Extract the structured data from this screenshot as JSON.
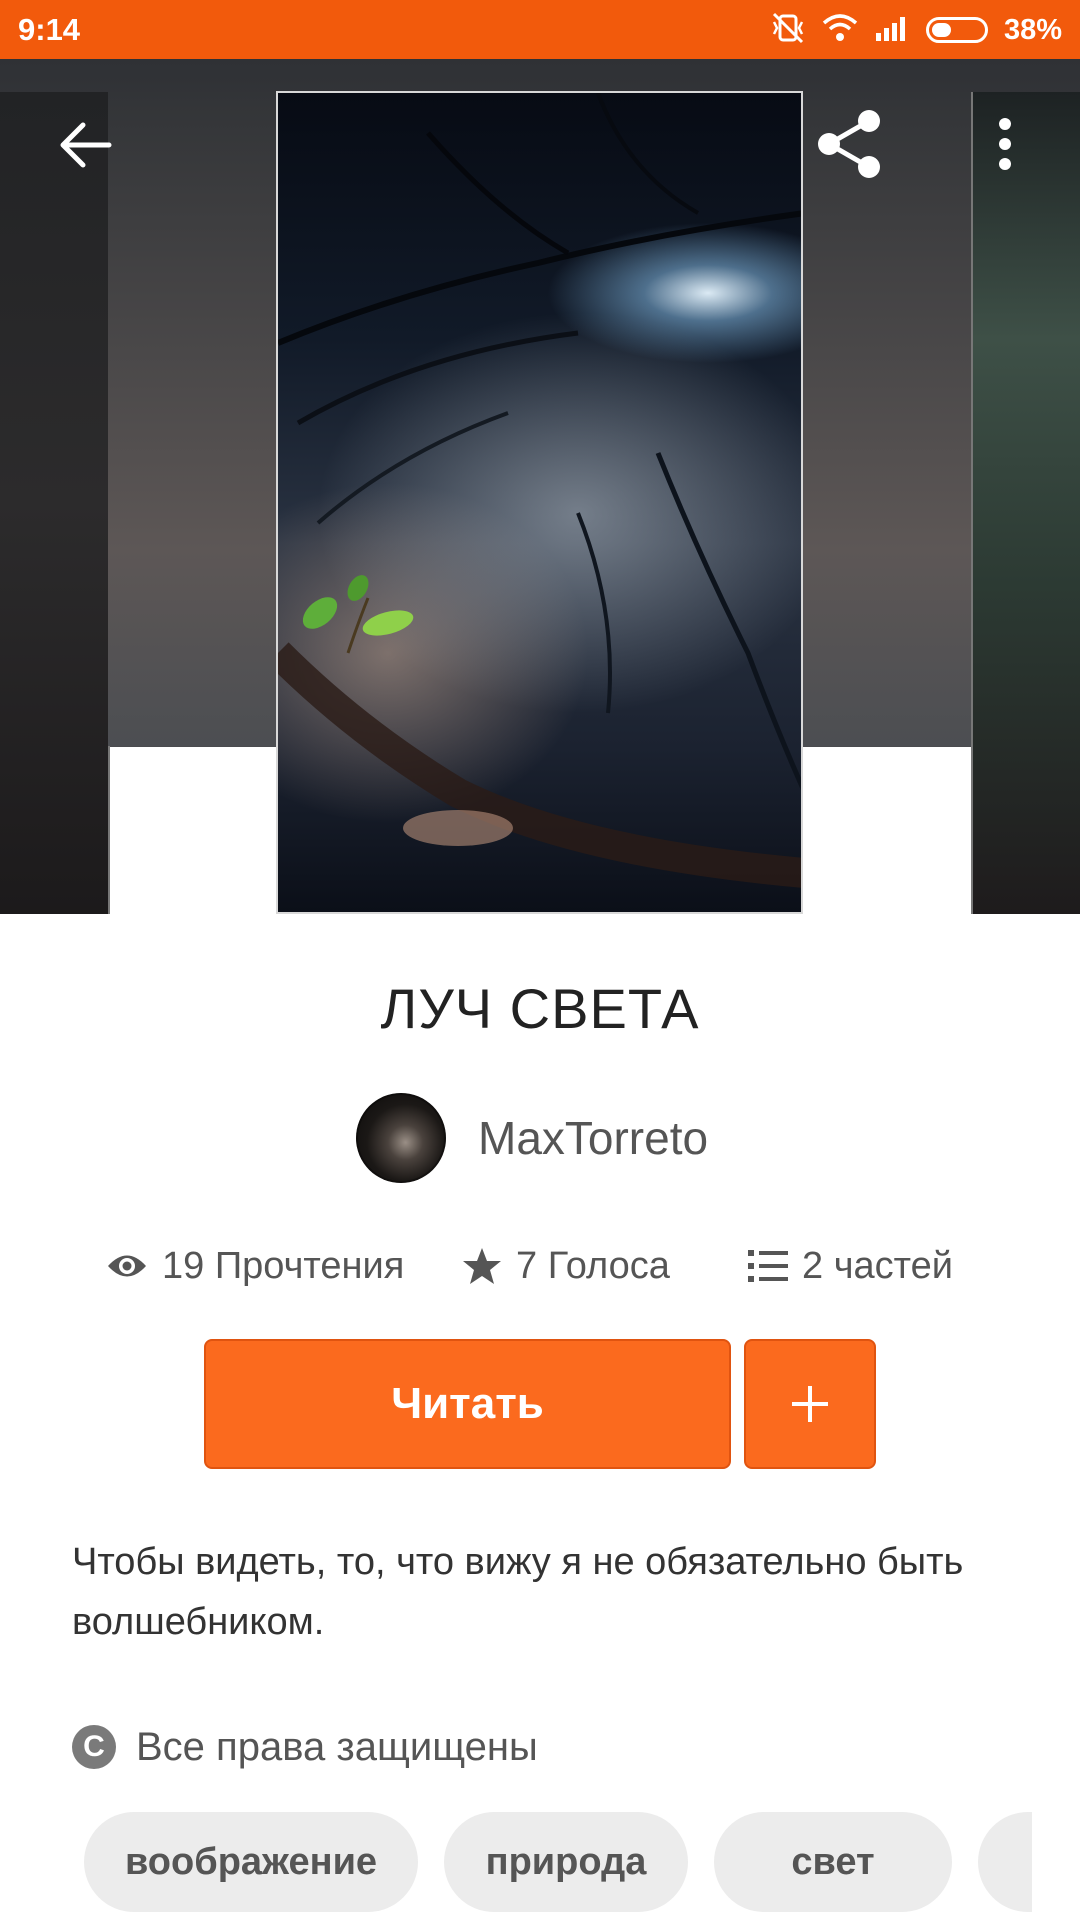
{
  "status_bar": {
    "time": "9:14",
    "battery_percent": "38%",
    "battery_level": 0.38,
    "icons": [
      "mute-vibrate-icon",
      "wifi-icon",
      "signal-icon",
      "battery-icon"
    ]
  },
  "header": {
    "back_icon": "arrow-left-icon",
    "share_icon": "share-icon",
    "menu_icon": "more-vertical-icon"
  },
  "story": {
    "title": "ЛУЧ СВЕТА",
    "author": "MaxTorreto",
    "stats": {
      "reads": "19 Прочтения",
      "votes": "7 Голоса",
      "parts": "2 частей"
    },
    "read_button": "Читать",
    "add_button": "+",
    "description": "Чтобы видеть, то, что вижу я не обязательно быть волшебником.",
    "rights": "Все права защищены",
    "tags": [
      "воображение",
      "природа",
      "свет"
    ]
  },
  "colors": {
    "accent": "#fb6a1e",
    "status_bar": "#f25a0c",
    "tag_bg": "#ececec"
  }
}
